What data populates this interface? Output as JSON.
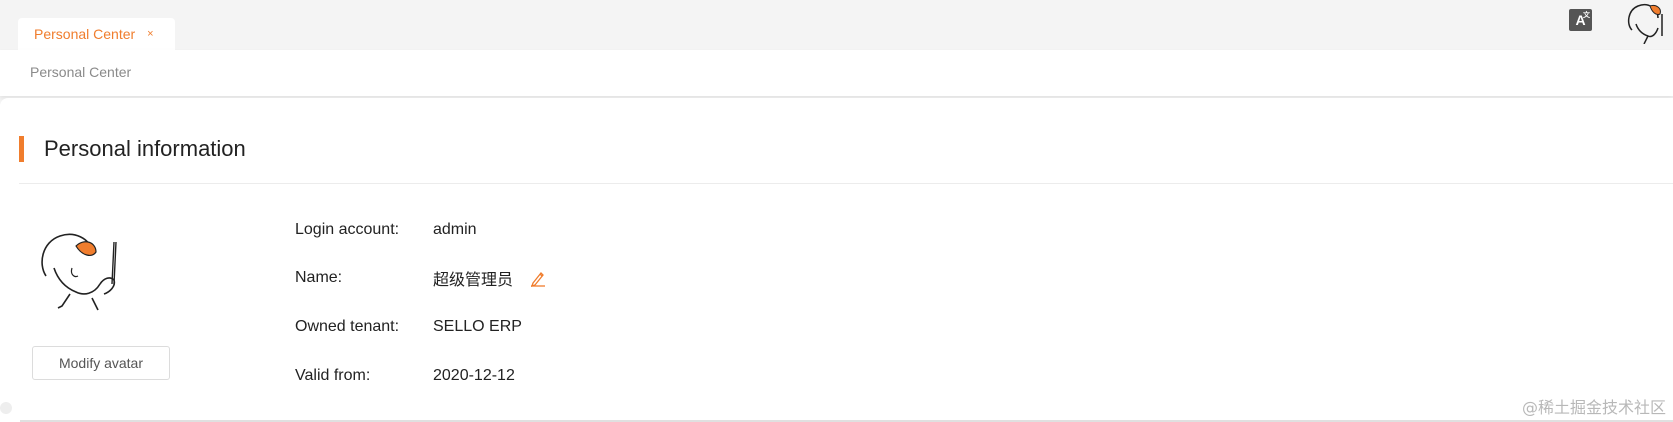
{
  "tabs": [
    {
      "label": "Personal Center",
      "active": true,
      "close_symbol": "×"
    }
  ],
  "header": {
    "translate_icon": "translate-icon",
    "translate_glyph": "A",
    "translate_sub": "文"
  },
  "breadcrumb": "Personal Center",
  "section": {
    "title": "Personal information"
  },
  "avatar": {
    "modify_label": "Modify avatar"
  },
  "info": [
    {
      "label": "Login account:",
      "value": "admin"
    },
    {
      "label": "Name:",
      "value": "超级管理员"
    },
    {
      "label": "Owned tenant:",
      "value": "SELLO ERP"
    },
    {
      "label": "Valid from:",
      "value": "2020-12-12"
    }
  ],
  "watermark": "@稀土掘金技术社区",
  "colors": {
    "accent": "#f07d2d",
    "background": "#f4f4f4",
    "text": "#222222"
  }
}
